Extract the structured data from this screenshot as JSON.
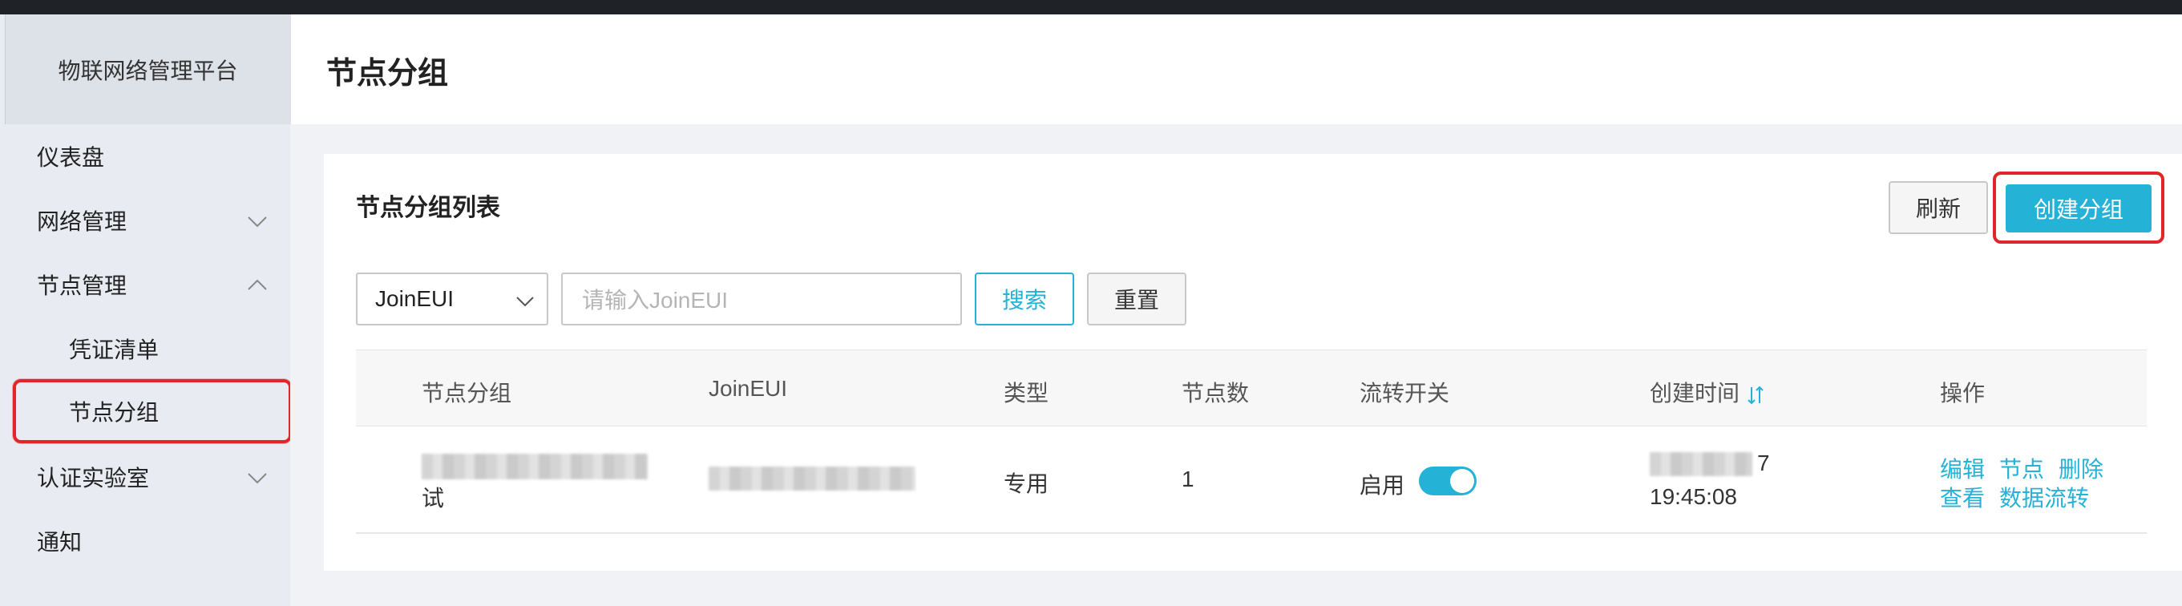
{
  "app": {
    "brand": "物联网络管理平台"
  },
  "sidebar": {
    "items": [
      {
        "label": "仪表盘"
      },
      {
        "label": "网络管理",
        "chevron": "chevron-down-icon"
      },
      {
        "label": "节点管理",
        "chevron": "chevron-up-icon"
      },
      {
        "label": "凭证清单"
      },
      {
        "label": "节点分组"
      },
      {
        "label": "认证实验室",
        "chevron": "chevron-down-icon"
      },
      {
        "label": "通知"
      }
    ]
  },
  "header": {
    "title": "节点分组"
  },
  "card": {
    "title": "节点分组列表",
    "refresh_label": "刷新",
    "create_label": "创建分组"
  },
  "filter": {
    "select_value": "JoinEUI",
    "input_placeholder": "请输入JoinEUI",
    "search_label": "搜索",
    "reset_label": "重置"
  },
  "table": {
    "columns": [
      "节点分组",
      "JoinEUI",
      "类型",
      "节点数",
      "流转开关",
      "创建时间",
      "操作"
    ],
    "rows": [
      {
        "group_name_tail": "试",
        "type": "专用",
        "node_count": "1",
        "switch_label": "启用",
        "switch_on": true,
        "created_date_tail": "7",
        "created_time": "19:45:08",
        "actions": {
          "edit": "编辑",
          "nodes": "节点",
          "delete": "删除",
          "view": "查看",
          "data_flow": "数据流转"
        }
      }
    ]
  },
  "colors": {
    "accent": "#24b2d6",
    "highlight": "#e0262b"
  }
}
